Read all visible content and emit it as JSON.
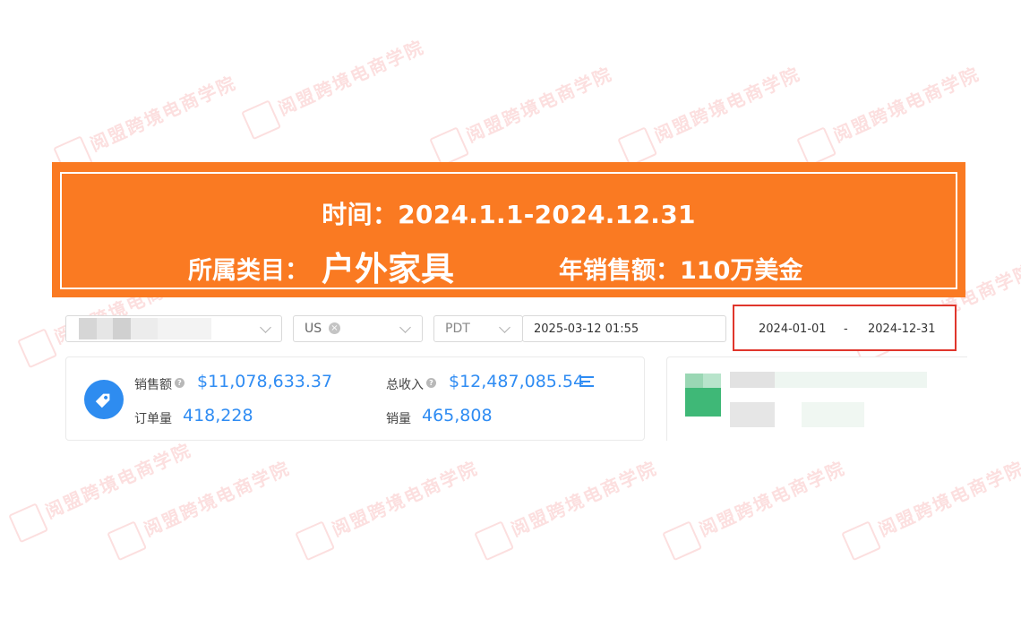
{
  "banner": {
    "time_line": "时间：2024.1.1-2024.12.31",
    "category_label": "所属类目：",
    "category_value": "户外家具",
    "sales_line": "年销售额：110万美金"
  },
  "filters": {
    "country": "US",
    "timezone": "PDT",
    "datetime": "2025-03-12 01:55",
    "range_start": "2024-01-01",
    "range_sep": "-",
    "range_end": "2024-12-31"
  },
  "stats": {
    "sales_label": "销售额",
    "sales_value": "$11,078,633.37",
    "revenue_label": "总收入",
    "revenue_value": "$12,487,085.54",
    "orders_label": "订单量",
    "orders_value": "418,228",
    "units_label": "销量",
    "units_value": "465,808"
  },
  "watermark": {
    "text": "阅盟跨境电商学院"
  },
  "colors": {
    "banner": "#fa7a22",
    "accent": "#2f8cf3",
    "highlight_border": "#e0362c"
  }
}
